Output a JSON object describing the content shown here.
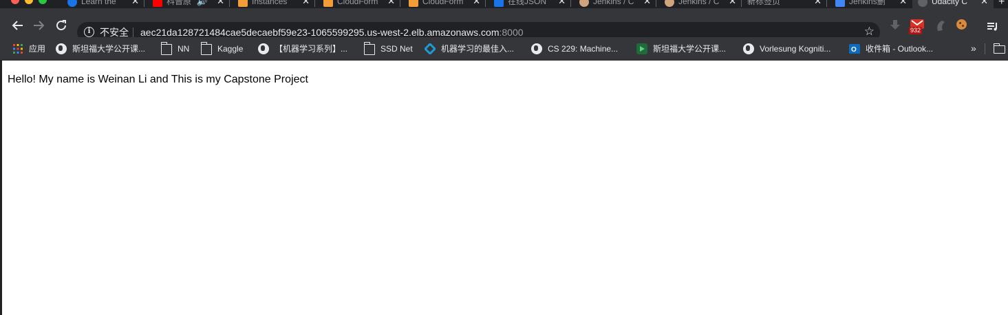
{
  "tabs": [
    {
      "title": "Learn the",
      "active": false,
      "favicon": "learn-icon",
      "color": "#1a73e8"
    },
    {
      "title": "科普原",
      "active": false,
      "favicon": "youtube-icon",
      "color": "#ff0000"
    },
    {
      "title": "Instances",
      "active": false,
      "favicon": "aws-icon",
      "color": "#f29d38"
    },
    {
      "title": "CloudForm",
      "active": false,
      "favicon": "aws-icon",
      "color": "#f29d38"
    },
    {
      "title": "CloudForm",
      "active": false,
      "favicon": "aws-icon",
      "color": "#f29d38"
    },
    {
      "title": "在线JSON",
      "active": false,
      "favicon": "json-icon",
      "color": "#1a73e8"
    },
    {
      "title": "Jenkins / C",
      "active": false,
      "favicon": "jenkins-icon",
      "color": "#d0a47c"
    },
    {
      "title": "Jenkins / C",
      "active": false,
      "favicon": "jenkins-icon",
      "color": "#d0a47c"
    },
    {
      "title": "新标签页",
      "active": false,
      "favicon": "",
      "color": ""
    },
    {
      "title": "Jenkins删",
      "active": false,
      "favicon": "home-icon",
      "color": "#4285f4"
    },
    {
      "title": "Udacity C",
      "active": true,
      "favicon": "udacity-icon",
      "color": "#5f6368"
    }
  ],
  "toolbar": {
    "security_label": "不安全",
    "url_host": "aec21da128721484cae5decaebf59e23-1065599295.us-west-2.elb.amazonaws.com",
    "url_port": ":8000",
    "mail_badge": "932"
  },
  "bookmarks": {
    "apps_label": "应用",
    "items": [
      {
        "label": "斯坦福大学公开课...",
        "icon": "globe-icon"
      },
      {
        "label": "NN",
        "icon": "folder-icon"
      },
      {
        "label": "Kaggle",
        "icon": "folder-icon"
      },
      {
        "label": "【机器学习系列】...",
        "icon": "globe-icon"
      },
      {
        "label": "SSD Net",
        "icon": "folder-icon"
      },
      {
        "label": "机器学习的最佳入...",
        "icon": "diamond-icon"
      },
      {
        "label": "CS 229: Machine...",
        "icon": "globe-icon"
      },
      {
        "label": "斯坦福大学公开课...",
        "icon": "play-icon"
      },
      {
        "label": "Vorlesung Kogniti...",
        "icon": "globe-icon"
      },
      {
        "label": "收件箱 - Outlook...",
        "icon": "outlook-icon"
      }
    ],
    "overflow": "»"
  },
  "page": {
    "text": "Hello! My name is Weinan Li and This is my Capstone Project"
  }
}
